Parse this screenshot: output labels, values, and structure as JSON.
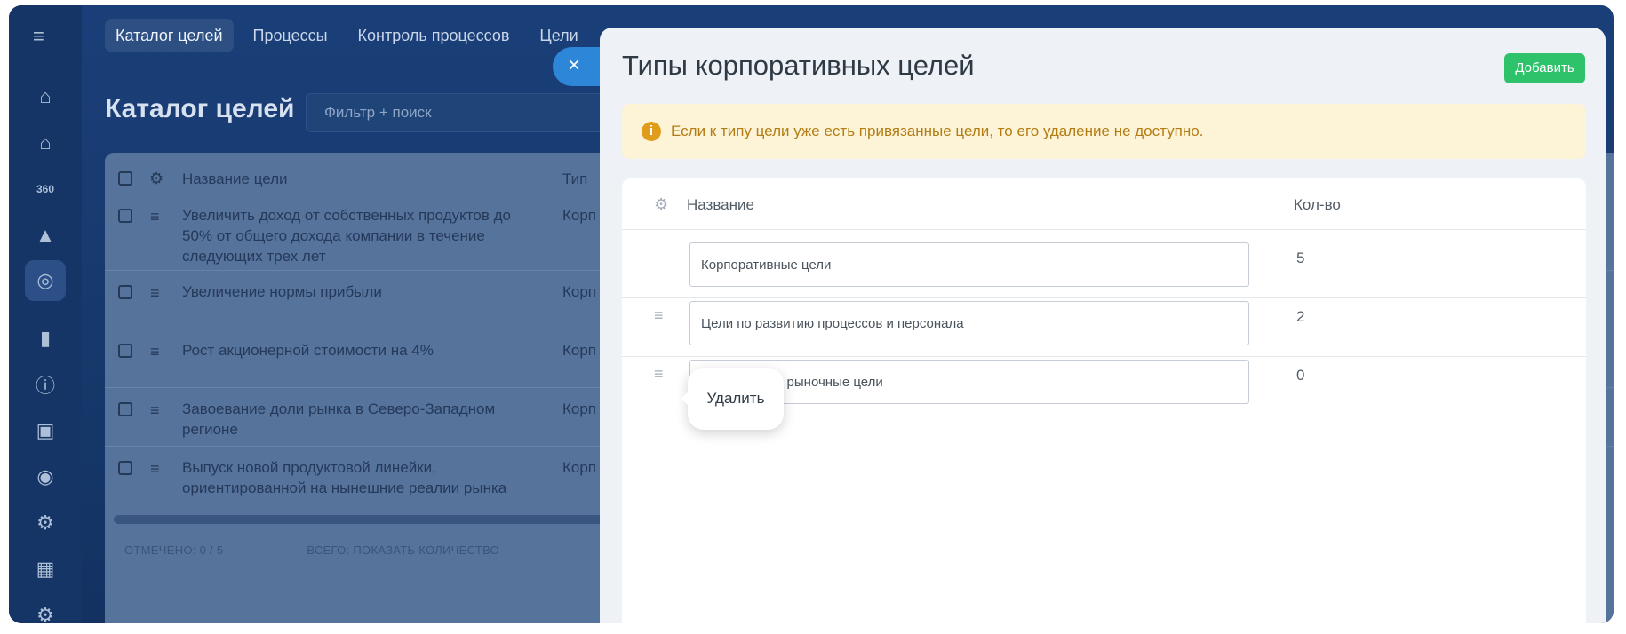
{
  "topnav": {
    "tabs": [
      {
        "label": "Каталог целей",
        "active": true
      },
      {
        "label": "Процессы",
        "active": false
      },
      {
        "label": "Контроль процессов",
        "active": false
      },
      {
        "label": "Цели",
        "active": false
      }
    ]
  },
  "sidebar": {
    "icons": [
      "menu-icon",
      "home-icon",
      "house-hand-icon",
      "360-icon",
      "graduation-cap-icon",
      "target-icon",
      "bar-chart-icon",
      "info-house-icon",
      "phone-book-icon",
      "gamepad-icon",
      "gears-icon",
      "building-chart-icon",
      "settings-icon"
    ]
  },
  "page": {
    "title": "Каталог целей",
    "filter_placeholder": "Фильтр + поиск"
  },
  "grid": {
    "columns": [
      "Название цели",
      "Тип"
    ],
    "rows": [
      {
        "name": "Увеличить доход от собственных продуктов до 50% от общего дохода компании в течение следующих трех лет",
        "type": "Корп цел"
      },
      {
        "name": "Увеличение нормы прибыли",
        "type": "Корп цел"
      },
      {
        "name": "Рост акционерной стоимости на 4%",
        "type": "Корп цел"
      },
      {
        "name": "Завоевание доли рынка в Северо-Западном регионе",
        "type": "Корп цел"
      },
      {
        "name": "Выпуск новой продуктовой линейки, ориентированной на нынешние реалии рынка",
        "type": "Корп цел"
      }
    ],
    "footer_selected": "ОТМЕЧЕНО: 0 / 5",
    "footer_total": "ВСЕГО: ПОКАЗАТЬ КОЛИЧЕСТВО"
  },
  "panel": {
    "title": "Типы корпоративных целей",
    "add_label": "Добавить",
    "close_symbol": "×",
    "alert": "Если к типу цели уже есть привязанные цели, то его удаление не доступно.",
    "table": {
      "col_name": "Название",
      "col_count": "Кол-во",
      "rows": [
        {
          "value": "Корпоративные цели",
          "count": "5"
        },
        {
          "value": "Цели по развитию процессов и персонала",
          "count": "2"
        },
        {
          "value": "и рыночные цели",
          "count": "0"
        }
      ]
    },
    "tooltip": "Удалить"
  },
  "colors": {
    "accent_green": "#2ec36a",
    "close_blue": "#2d86d8",
    "alert_bg": "#fdf3d6",
    "alert_text": "#b37d14",
    "background_navy": "#173a6f"
  }
}
